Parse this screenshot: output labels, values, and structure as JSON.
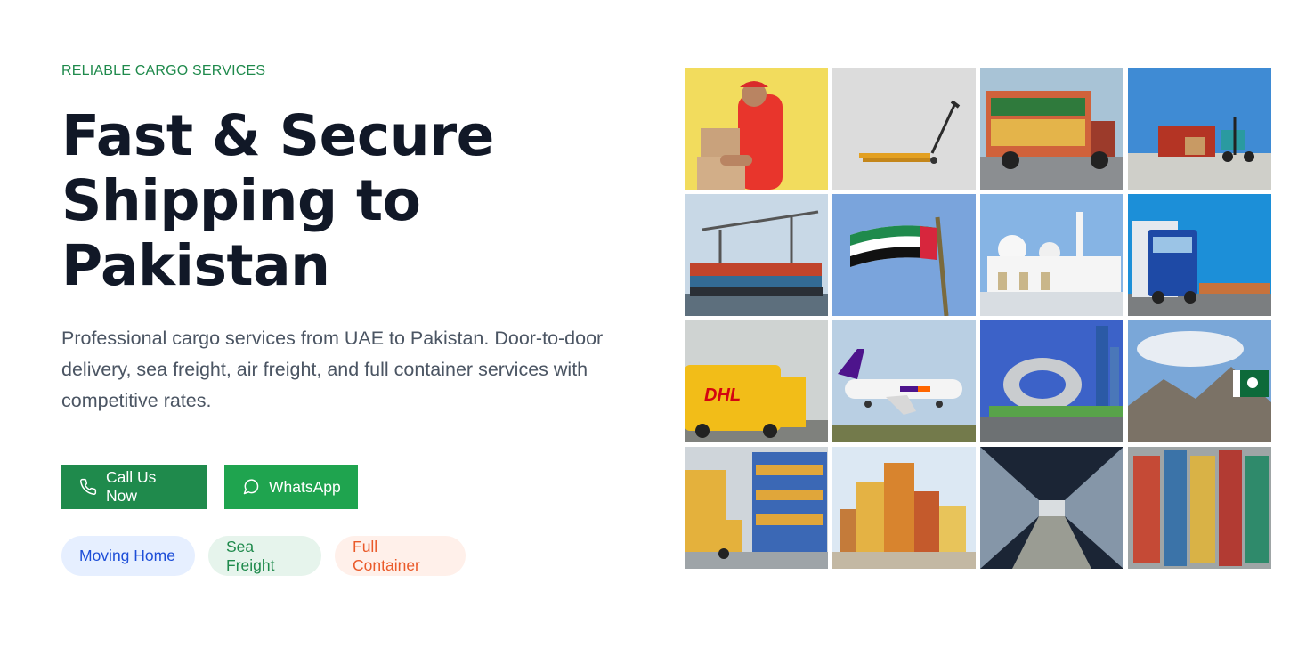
{
  "hero": {
    "eyebrow": "RELIABLE CARGO SERVICES",
    "headline_line1": "Fast & Secure",
    "headline_line2": "Shipping to",
    "headline_line3": "Pakistan",
    "lead": "Professional cargo services from UAE to Pakistan. Door-to-door delivery, sea freight, air freight, and full container services with competitive rates."
  },
  "cta": {
    "call_label": "Call Us Now",
    "call_icon": "phone-icon",
    "whatsapp_label": "WhatsApp",
    "whatsapp_icon": "chat-bubble-icon"
  },
  "tags": [
    {
      "label": "Moving Home",
      "color": "#1d4ed8",
      "bg": "#e6efff"
    },
    {
      "label": "Sea Freight",
      "color": "#1f8a4c",
      "bg": "#e6f4ec"
    },
    {
      "label": "Full Container",
      "color": "#ea5a2a",
      "bg": "#fff0ea"
    }
  ],
  "gallery": {
    "photos": [
      "delivery-man-with-boxes",
      "pallet-jack",
      "decorated-pakistani-truck",
      "container-truck-with-forklift",
      "container-port-cranes",
      "uae-flag",
      "grand-mosque",
      "blue-scania-truck",
      "dhl-van",
      "fedex-cargo-plane",
      "museum-of-the-future",
      "pakistan-flag-mountains",
      "warehouse-racks-forklift",
      "stacked-containers",
      "warehouse-aisle",
      "container-yard-aerial"
    ],
    "dhl_text": "DHL"
  },
  "colors": {
    "brand_green": "#1f8a4c",
    "whatsapp_green": "#1fa44f",
    "headline": "#111827",
    "body_text": "#4b5563"
  }
}
